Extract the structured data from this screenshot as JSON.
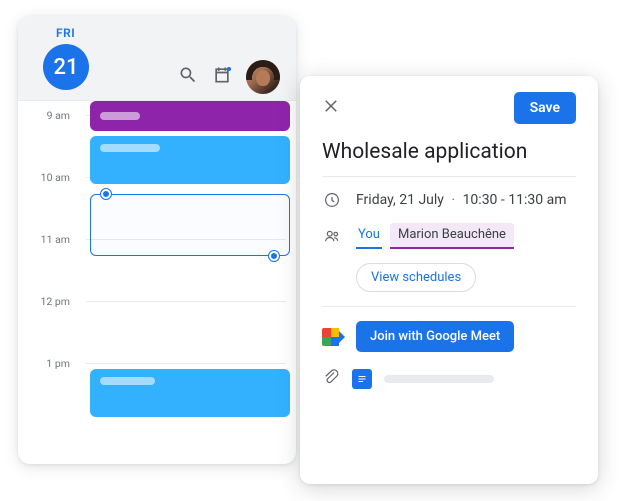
{
  "day": {
    "weekday": "FRI",
    "date_num": "21",
    "hours": [
      "9 am",
      "10 am",
      "11 am",
      "12 pm",
      "1 pm"
    ]
  },
  "detail": {
    "save": "Save",
    "title": "Wholesale application",
    "date": "Friday, 21 July",
    "time": "10:30 - 11:30 am",
    "you": "You",
    "guest": "Marion Beauchêne",
    "view_schedules": "View schedules",
    "join_meet": "Join with Google Meet"
  }
}
